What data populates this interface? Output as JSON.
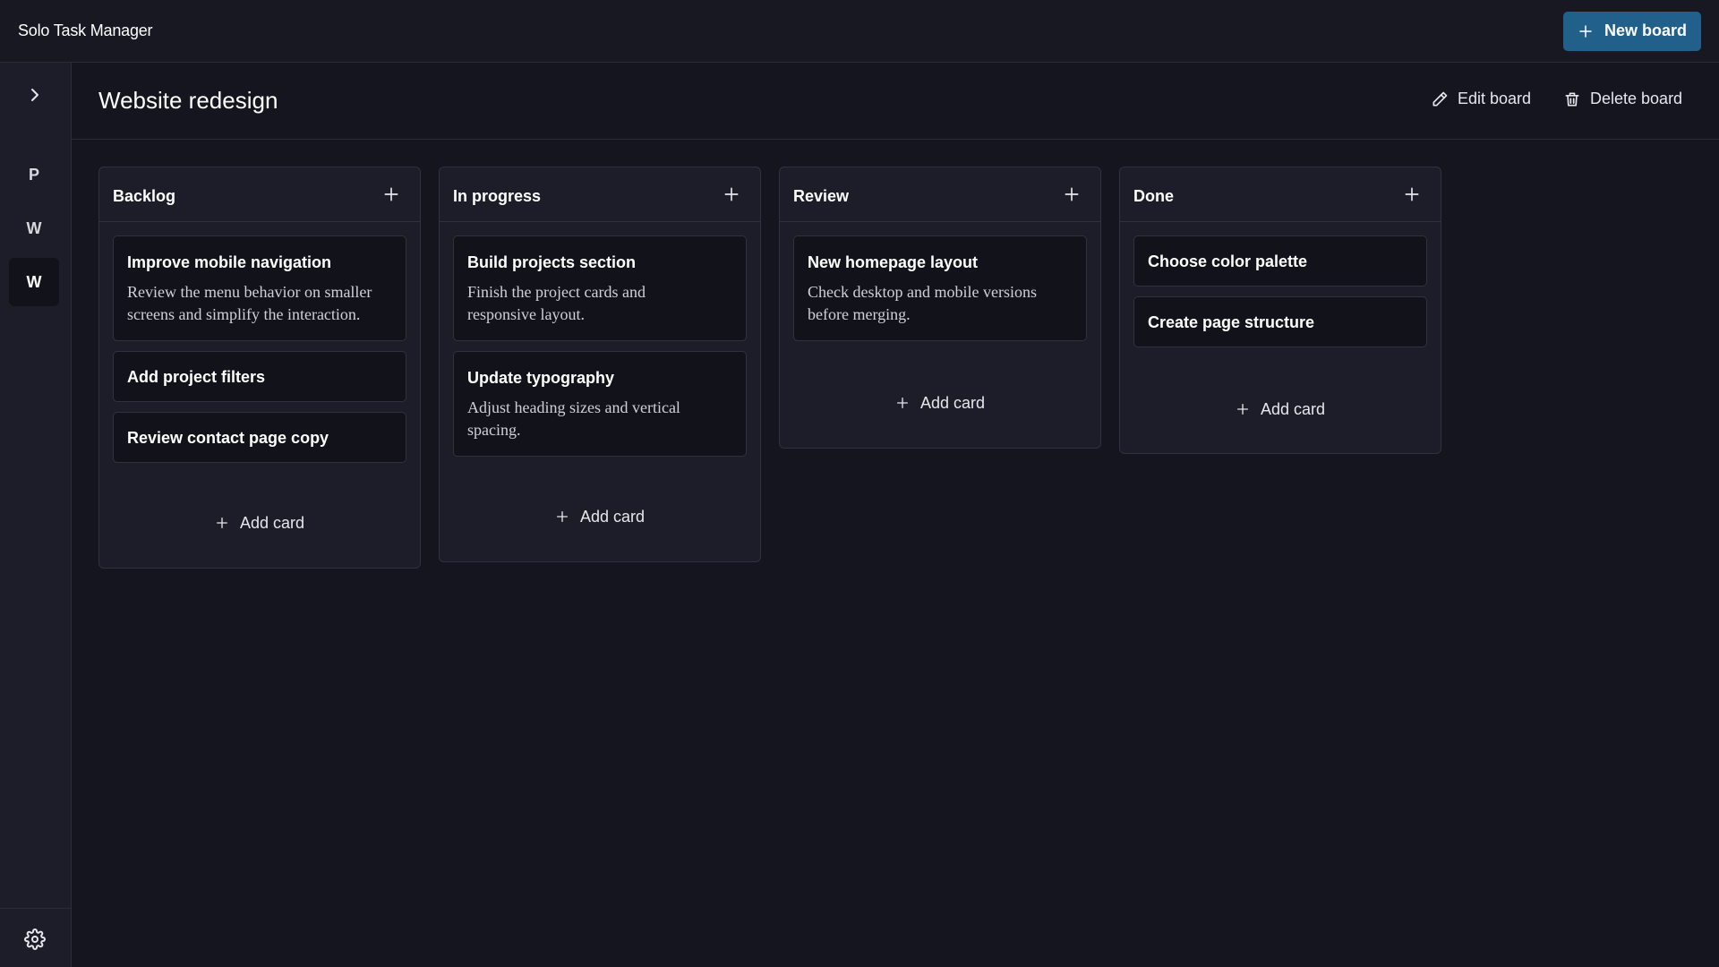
{
  "app": {
    "title": "Solo Task Manager",
    "new_board_label": "New board"
  },
  "sidebar": {
    "items": [
      {
        "label": "P",
        "active": false
      },
      {
        "label": "W",
        "active": false
      },
      {
        "label": "W",
        "active": true
      }
    ]
  },
  "board": {
    "title": "Website redesign",
    "edit_label": "Edit board",
    "delete_label": "Delete board"
  },
  "columns": [
    {
      "title": "Backlog",
      "add_label": "Add card",
      "cards": [
        {
          "title": "Improve mobile navigation",
          "desc_lines": [
            "Review the menu behavior on smaller",
            "screens and simplify the interaction."
          ]
        },
        {
          "title": "Add project filters",
          "desc_lines": []
        },
        {
          "title": "Review contact page copy",
          "desc_lines": []
        }
      ]
    },
    {
      "title": "In progress",
      "add_label": "Add card",
      "cards": [
        {
          "title": "Build projects section",
          "desc_lines": [
            "Finish the project cards and",
            "responsive layout."
          ]
        },
        {
          "title": "Update typography",
          "desc_lines": [
            "Adjust heading sizes and vertical",
            "spacing."
          ]
        }
      ]
    },
    {
      "title": "Review",
      "add_label": "Add card",
      "cards": [
        {
          "title": "New homepage layout",
          "desc_lines": [
            "Check desktop and mobile versions",
            "before merging."
          ]
        }
      ]
    },
    {
      "title": "Done",
      "add_label": "Add card",
      "cards": [
        {
          "title": "Choose color palette",
          "desc_lines": []
        },
        {
          "title": "Create page structure",
          "desc_lines": []
        }
      ]
    }
  ],
  "colors": {
    "accent": "#21608a",
    "background": "#14151e",
    "panel": "#1c1d28",
    "card": "#12131a"
  },
  "icons": [
    "plus-icon",
    "chevron-right-icon",
    "pencil-icon",
    "trash-icon",
    "gear-icon"
  ]
}
